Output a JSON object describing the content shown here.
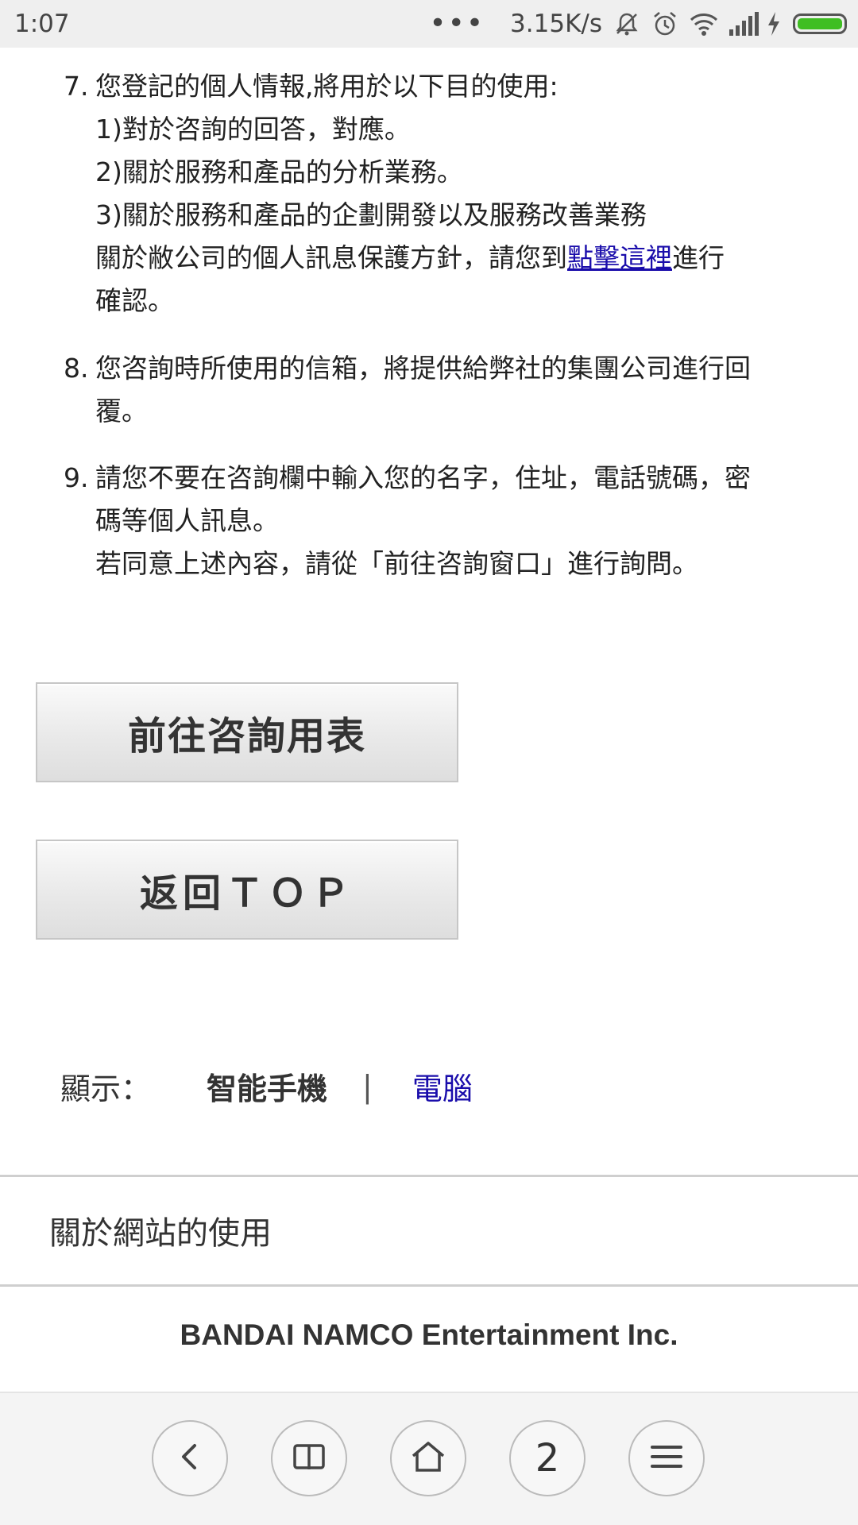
{
  "status_bar": {
    "time": "1:07",
    "network_speed": "3.15K/s",
    "icons": [
      "more-dots-icon",
      "mute-icon",
      "alarm-icon",
      "wifi-icon",
      "signal-icon",
      "charging-icon",
      "battery-icon"
    ]
  },
  "terms": [
    {
      "number": "7.",
      "lines": [
        "您登記的個人情報,將用於以下目的使用:",
        "1)對於咨詢的回答，對應。",
        "2)關於服務和產品的分析業務。",
        "3)關於服務和產品的企劃開發以及服務改善業務"
      ],
      "policy_prefix": "關於敝公司的個人訊息保護方針，請您到",
      "policy_link": "點擊這裡",
      "policy_suffix": "進行",
      "policy_end": "確認。"
    },
    {
      "number": "8.",
      "lines": [
        "您咨詢時所使用的信箱，將提供給弊社的集團公司進行回",
        "覆。"
      ]
    },
    {
      "number": "9.",
      "lines": [
        "請您不要在咨詢欄中輸入您的名字，住址，電話號碼，密",
        "碼等個人訊息。",
        "若同意上述內容，請從「前往咨詢窗口」進行詢問。"
      ]
    }
  ],
  "buttons": {
    "inquiry_form": "前往咨詢用表",
    "back_top": "返回ＴＯＰ"
  },
  "display_mode": {
    "label": "顯示：",
    "smartphone": "智能手機",
    "separator": "|",
    "pc": "電腦"
  },
  "footer": {
    "about_site": "關於網站的使用",
    "company": "BANDAI NAMCO Entertainment Inc."
  },
  "browser_nav": {
    "tab_count": "2",
    "icons": [
      "back-icon",
      "bookmarks-icon",
      "home-icon",
      "tabs-icon",
      "menu-icon"
    ]
  }
}
